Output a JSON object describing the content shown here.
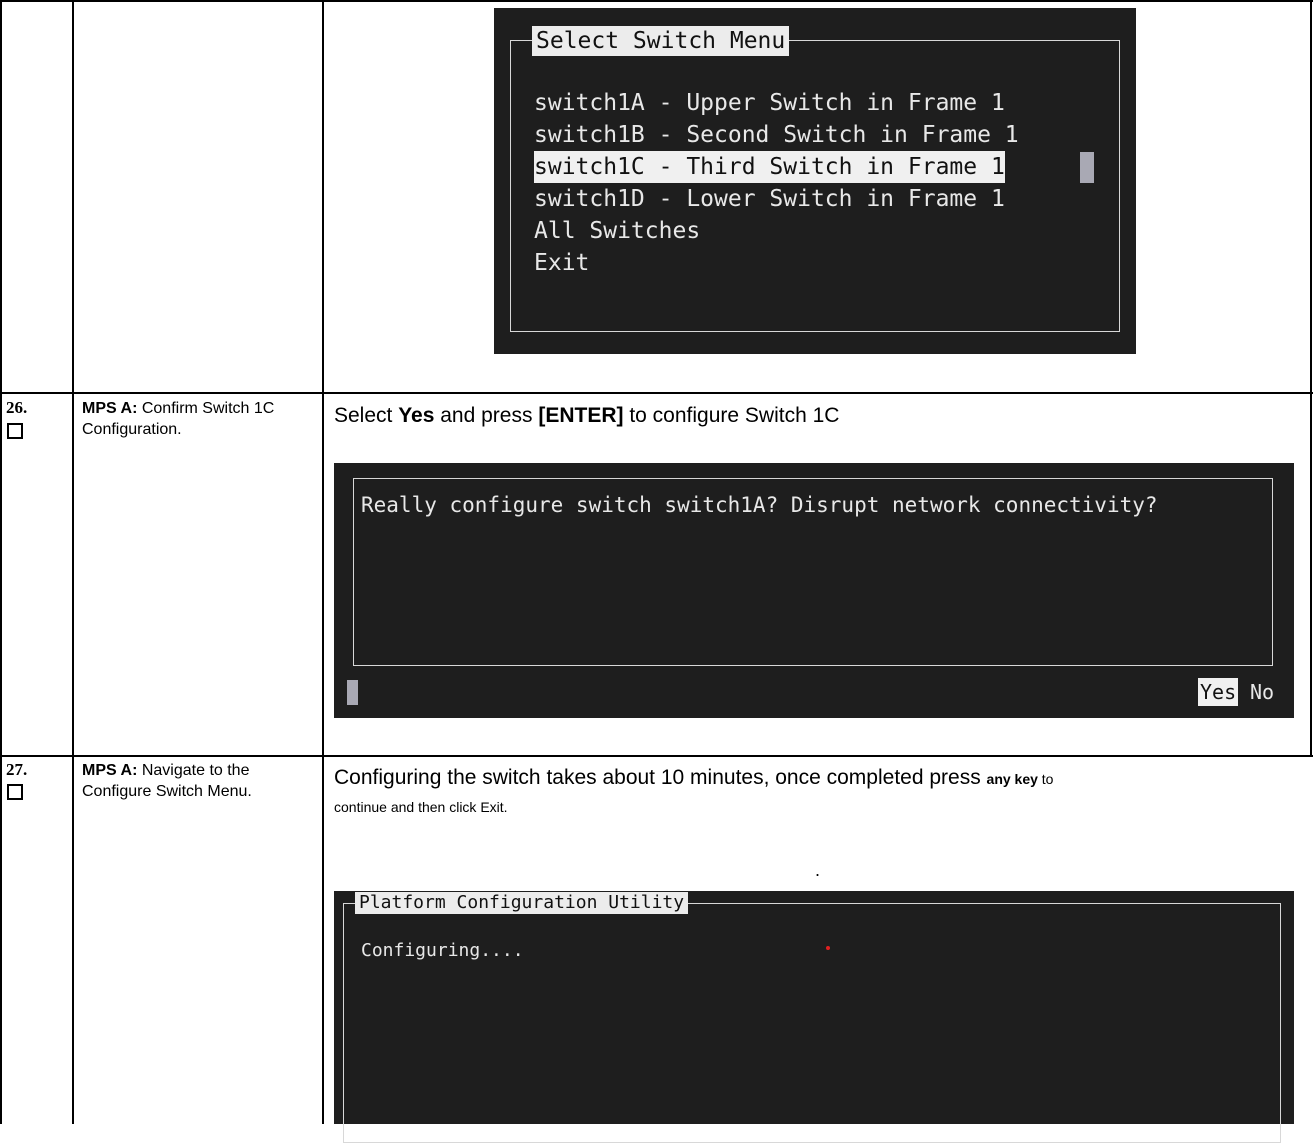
{
  "row_top": {
    "terminal": {
      "title": "Select Switch Menu",
      "items": [
        "switch1A - Upper Switch in Frame 1",
        "switch1B - Second Switch in Frame 1",
        "switch1C - Third Switch in Frame 1",
        "switch1D - Lower Switch in Frame 1",
        "All Switches",
        "Exit"
      ],
      "selected_index": 2
    }
  },
  "step26": {
    "number": "26.",
    "desc_bold": "MPS A:",
    "desc_text": " Confirm Switch 1C Configuration.",
    "instr_pre": "Select ",
    "instr_yes": "Yes",
    "instr_mid": " and press ",
    "instr_enter": "[ENTER]",
    "instr_post": " to configure Switch 1C",
    "terminal": {
      "question": "Really configure switch switch1A? Disrupt network connectivity?",
      "yes": "Yes",
      "no": "No"
    }
  },
  "step27": {
    "number": "27.",
    "desc_bold": "MPS A:",
    "desc_text": " Navigate to the Configure Switch Menu.",
    "instr_line1": "Configuring the switch takes about 10 minutes, once completed press ",
    "instr_anykey": "any key",
    "instr_after": " to",
    "instr_line2": "continue and then click Exit.",
    "dot": ".",
    "terminal": {
      "title": "Platform Configuration Utility",
      "status": "Configuring...."
    }
  },
  "colors": {
    "terminal_bg": "#1e1e1e",
    "terminal_text": "#e8e8e8",
    "highlight_bg": "#f0f0f0",
    "red_dot": "#e02020"
  }
}
